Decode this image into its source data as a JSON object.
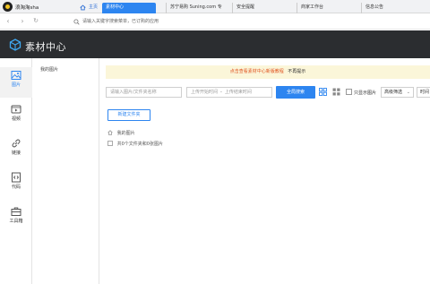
{
  "browser": {
    "user_name": "浪淘淘sha",
    "tabs": [
      {
        "label": "主页"
      },
      {
        "label": "素材中心"
      },
      {
        "label": "苏宁易购 Suning.com 专"
      },
      {
        "label": "安全提醒"
      },
      {
        "label": "商家工作台"
      },
      {
        "label": "信息公告"
      }
    ],
    "address_placeholder": "请输入关键字搜索菜单，已订购的应用"
  },
  "app": {
    "logo_text": "素材中心"
  },
  "sidebar": {
    "items": [
      {
        "label": "图片",
        "icon": "image-icon",
        "active": true
      },
      {
        "label": "视频",
        "icon": "video-icon",
        "active": false
      },
      {
        "label": "链接",
        "icon": "link-icon",
        "active": false
      },
      {
        "label": "代码",
        "icon": "code-icon",
        "active": false
      },
      {
        "label": "工具箱",
        "icon": "toolbox-icon",
        "active": false
      }
    ]
  },
  "folder_panel": {
    "item": "我的图片"
  },
  "notice": {
    "link_text": "点击查看素材中心新版教程",
    "dismiss_text": "不再提示"
  },
  "toolbar": {
    "search_placeholder": "请输入图片/文件夹名称",
    "date_start_placeholder": "上传开始时间",
    "date_sep": "-",
    "date_end_placeholder": "上传结束时间",
    "search_button": "全局搜索",
    "only_show_images": "只显示图片",
    "filter_select": "高级筛选",
    "time_select": "时间"
  },
  "content": {
    "new_folder_button": "新建文件夹",
    "breadcrumb": "我的图片",
    "summary": "共0个文件夹和0张图片"
  },
  "colors": {
    "accent": "#2d85f0",
    "header_bg": "#2b2d30",
    "notice_bg": "#fbf6d9",
    "notice_link": "#e0531f"
  }
}
